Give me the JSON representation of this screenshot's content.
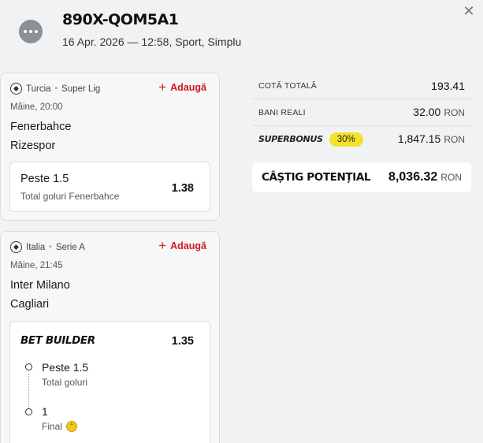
{
  "header": {
    "ticket_id": "890X-QOM5A1",
    "meta": "16 Apr. 2026 — 12:58, Sport, Simplu",
    "menu_icon": "more-dots-icon",
    "close_icon": "close-icon",
    "close_glyph": "✕"
  },
  "bets": [
    {
      "country": "Turcia",
      "league": "Super Lig",
      "add_label": "Adaugă",
      "time": "Mâine, 20:00",
      "home": "Fenerbahce",
      "away": "Rizespor",
      "pick": "Peste 1.5",
      "market": "Total goluri Fenerbahce",
      "odds": "1.38"
    },
    {
      "country": "Italia",
      "league": "Serie A",
      "add_label": "Adaugă",
      "time": "Mâine, 21:45",
      "home": "Inter Milano",
      "away": "Cagliari",
      "builder_title": "BET BUILDER",
      "odds": "1.35",
      "legs": [
        {
          "pick": "Peste 1.5",
          "market": "Total goluri"
        },
        {
          "pick": "1",
          "market": "Final"
        }
      ]
    }
  ],
  "summary": {
    "total_odds_label": "COTĂ TOTALĂ",
    "total_odds": "193.41",
    "stake_label": "BANI REALI",
    "stake": "32.00",
    "currency": "RON",
    "superbonus_label": "SUPERBONUS",
    "superbonus_pct": "30%",
    "superbonus_value": "1,847.15",
    "win_label": "CÂȘTIG POTENȚIAL",
    "win_value": "8,036.32"
  },
  "colors": {
    "accent_red": "#d0191f",
    "bonus_yellow": "#f3e229",
    "background": "#f1f2f4"
  }
}
